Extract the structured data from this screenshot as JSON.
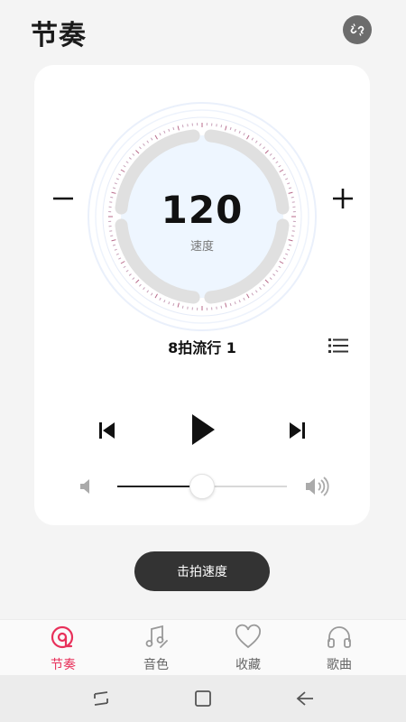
{
  "header": {
    "title": "节奏",
    "link_icon": "unlink-icon"
  },
  "metronome": {
    "bpm": "120",
    "bpm_label": "速度",
    "minus_icon": "minus-icon",
    "plus_icon": "plus-icon",
    "rhythm_name": "8拍流行 1",
    "list_icon": "list-icon"
  },
  "playback": {
    "prev_icon": "skip-previous-icon",
    "play_icon": "play-icon",
    "next_icon": "skip-next-icon"
  },
  "volume": {
    "level": 0.5,
    "low_icon": "volume-low-icon",
    "high_icon": "volume-high-icon"
  },
  "tap_tempo": {
    "label": "击拍速度"
  },
  "tabs": [
    {
      "label": "节奏",
      "icon": "rhythm-icon",
      "active": true
    },
    {
      "label": "音色",
      "icon": "music-note-icon",
      "active": false
    },
    {
      "label": "收藏",
      "icon": "heart-icon",
      "active": false
    },
    {
      "label": "歌曲",
      "icon": "headphones-icon",
      "active": false
    }
  ],
  "colors": {
    "accent": "#e8305a",
    "dark_button": "#333333",
    "dial_ring": "#e0e0e0",
    "dial_center": "#eef6ff"
  }
}
